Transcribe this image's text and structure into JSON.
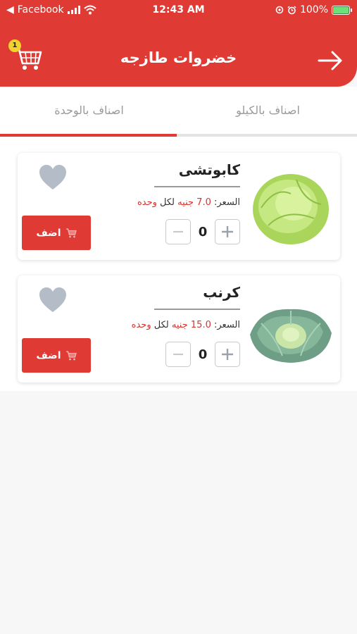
{
  "status_bar": {
    "back_app": "Facebook",
    "time": "12:43 AM",
    "battery": "100%"
  },
  "header": {
    "title": "خضروات طازجه",
    "cart_count": "1"
  },
  "tabs": [
    {
      "label": "اصناف بالكيلو",
      "active": false
    },
    {
      "label": "اصناف بالوحدة",
      "active": true
    }
  ],
  "products": [
    {
      "name": "كابوتشى",
      "price_label": "السعر:",
      "price_value": "7.0",
      "currency": "جنيه",
      "per": "لكل",
      "unit": "وحده",
      "quantity": "0",
      "add_label": "اضف",
      "image": "lettuce-image"
    },
    {
      "name": "كرنب",
      "price_label": "السعر:",
      "price_value": "15.0",
      "currency": "جنيه",
      "per": "لكل",
      "unit": "وحده",
      "quantity": "0",
      "add_label": "اضف",
      "image": "cabbage-image"
    }
  ],
  "colors": {
    "primary": "#e03a35",
    "badge": "#f2d22e",
    "heart": "#b4bcc8"
  }
}
